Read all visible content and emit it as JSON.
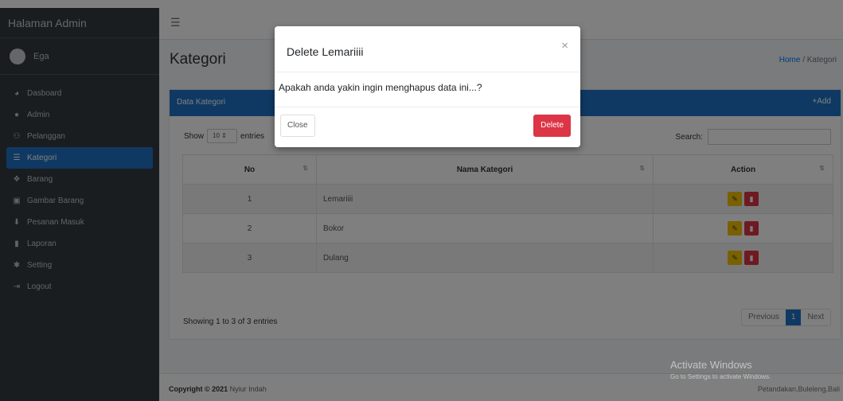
{
  "colors": {
    "sidebar_bg": "#343a40",
    "primary": "#1e73c6",
    "danger": "#dc3545",
    "warning": "#f3c100"
  },
  "sidebar": {
    "brand": "Halaman Admin",
    "user": "Ega",
    "items": [
      {
        "label": "Dasboard",
        "icon": "tachometer-icon"
      },
      {
        "label": "Admin",
        "icon": "user-icon"
      },
      {
        "label": "Pelanggan",
        "icon": "users-icon"
      },
      {
        "label": "Kategori",
        "icon": "list-icon",
        "active": true
      },
      {
        "label": "Barang",
        "icon": "cubes-icon"
      },
      {
        "label": "Gambar Barang",
        "icon": "image-icon"
      },
      {
        "label": "Pesanan Masuk",
        "icon": "download-icon"
      },
      {
        "label": "Laporan",
        "icon": "file-icon"
      },
      {
        "label": "Setting",
        "icon": "gear-icon"
      },
      {
        "label": "Logout",
        "icon": "sign-out-icon"
      }
    ]
  },
  "header": {
    "title": "Kategori",
    "breadcrumb_home": "Home",
    "breadcrumb_sep": "/",
    "breadcrumb_current": "Kategori"
  },
  "card": {
    "title": "Data Kategori",
    "add_label": "Add",
    "show_label": "Show",
    "page_size": "10",
    "entries_label": "entries",
    "search_label": "Search:",
    "columns": [
      "No",
      "Nama Kategori",
      "Action"
    ],
    "rows": [
      {
        "no": "1",
        "name": "Lemariiii"
      },
      {
        "no": "2",
        "name": "Bokor"
      },
      {
        "no": "3",
        "name": "Dulang"
      }
    ],
    "info": "Showing 1 to 3 of 3 entries",
    "pager": {
      "prev": "Previous",
      "current": "1",
      "next": "Next"
    }
  },
  "footer": {
    "copyright_bold": "Copyright © 2021",
    "copyright_name": "Nyiur Indah",
    "location": "Petandakan,Buleleng,Bali"
  },
  "watermark": {
    "title": "Activate Windows",
    "subtitle": "Go to Settings to activate Windows."
  },
  "modal": {
    "title": "Delete Lemariiii",
    "close_symbol": "×",
    "message": "Apakah anda yakin ingin menghapus data ini...?",
    "close_label": "Close",
    "delete_label": "Delete"
  }
}
